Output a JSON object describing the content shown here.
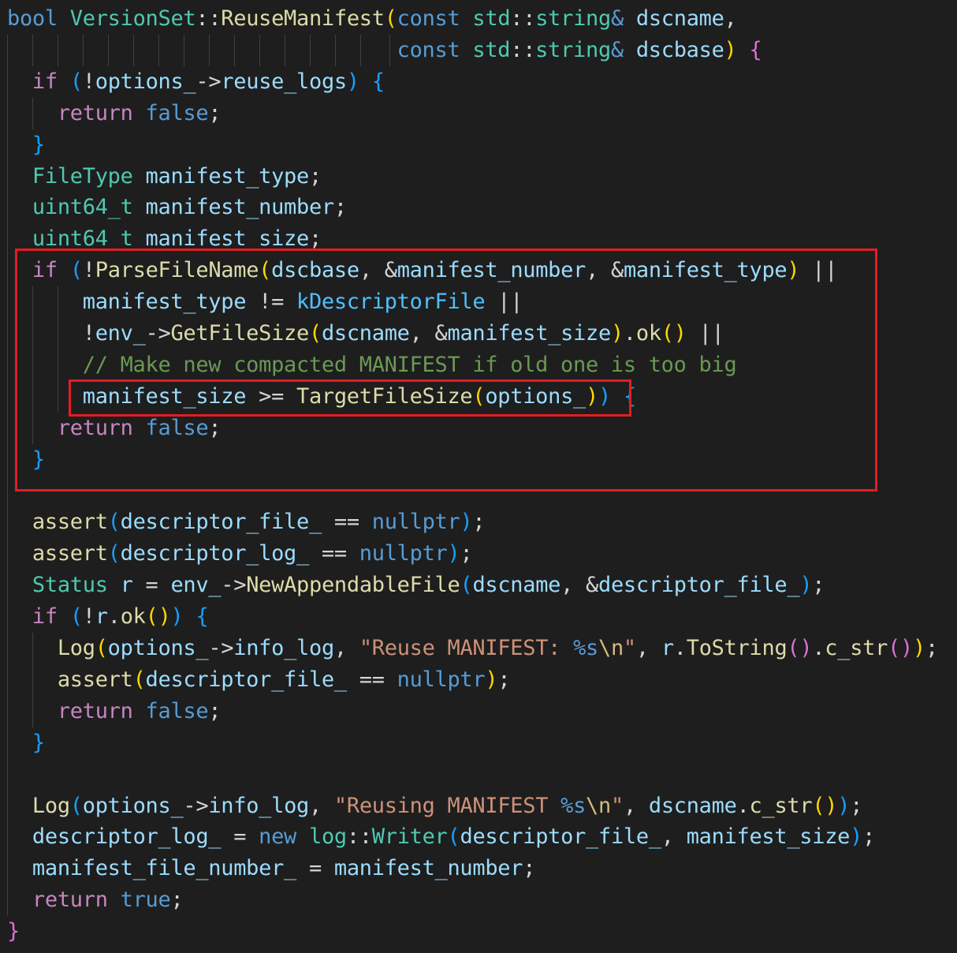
{
  "colors": {
    "background": "#1e1e1e",
    "keyword": "#569cd6",
    "control": "#c586c0",
    "type": "#4ec9b0",
    "variable": "#9cdcfe",
    "function": "#dcdcaa",
    "string": "#ce9178",
    "escape": "#d7ba7d",
    "comment": "#6a9955",
    "highlight_box": "#e51c23"
  },
  "code": [
    [
      [
        "k",
        "bool"
      ],
      [
        "p",
        " "
      ],
      [
        "t",
        "VersionSet"
      ],
      [
        "p",
        "::"
      ],
      [
        "f",
        "ReuseManifest"
      ],
      [
        "b1",
        "("
      ],
      [
        "k",
        "const"
      ],
      [
        "p",
        " "
      ],
      [
        "t",
        "std"
      ],
      [
        "p",
        "::"
      ],
      [
        "t",
        "string"
      ],
      [
        "k",
        "&"
      ],
      [
        "p",
        " "
      ],
      [
        "v",
        "dscname"
      ],
      [
        "p",
        ","
      ]
    ],
    [
      [
        "p",
        "                               "
      ],
      [
        "k",
        "const"
      ],
      [
        "p",
        " "
      ],
      [
        "t",
        "std"
      ],
      [
        "p",
        "::"
      ],
      [
        "t",
        "string"
      ],
      [
        "k",
        "&"
      ],
      [
        "p",
        " "
      ],
      [
        "v",
        "dscbase"
      ],
      [
        "b1",
        ")"
      ],
      [
        "p",
        " "
      ],
      [
        "b2",
        "{"
      ]
    ],
    [
      [
        "p",
        "  "
      ],
      [
        "c",
        "if"
      ],
      [
        "p",
        " "
      ],
      [
        "b3",
        "("
      ],
      [
        "p",
        "!"
      ],
      [
        "v",
        "options_"
      ],
      [
        "p",
        "->"
      ],
      [
        "v",
        "reuse_logs"
      ],
      [
        "b3",
        ")"
      ],
      [
        "p",
        " "
      ],
      [
        "b3",
        "{"
      ]
    ],
    [
      [
        "p",
        "    "
      ],
      [
        "c",
        "return"
      ],
      [
        "p",
        " "
      ],
      [
        "k",
        "false"
      ],
      [
        "p",
        ";"
      ]
    ],
    [
      [
        "p",
        "  "
      ],
      [
        "b3",
        "}"
      ]
    ],
    [
      [
        "p",
        "  "
      ],
      [
        "t",
        "FileType"
      ],
      [
        "p",
        " "
      ],
      [
        "v",
        "manifest_type"
      ],
      [
        "p",
        ";"
      ]
    ],
    [
      [
        "p",
        "  "
      ],
      [
        "t",
        "uint64_t"
      ],
      [
        "p",
        " "
      ],
      [
        "v",
        "manifest_number"
      ],
      [
        "p",
        ";"
      ]
    ],
    [
      [
        "p",
        "  "
      ],
      [
        "t",
        "uint64_t"
      ],
      [
        "p",
        " "
      ],
      [
        "v",
        "manifest_size"
      ],
      [
        "p",
        ";"
      ]
    ],
    [
      [
        "p",
        "  "
      ],
      [
        "c",
        "if"
      ],
      [
        "p",
        " "
      ],
      [
        "b3",
        "("
      ],
      [
        "p",
        "!"
      ],
      [
        "f",
        "ParseFileName"
      ],
      [
        "b1",
        "("
      ],
      [
        "v",
        "dscbase"
      ],
      [
        "p",
        ", &"
      ],
      [
        "v",
        "manifest_number"
      ],
      [
        "p",
        ", &"
      ],
      [
        "v",
        "manifest_type"
      ],
      [
        "b1",
        ")"
      ],
      [
        "p",
        " ||"
      ]
    ],
    [
      [
        "p",
        "      "
      ],
      [
        "v",
        "manifest_type"
      ],
      [
        "p",
        " != "
      ],
      [
        "cn",
        "kDescriptorFile"
      ],
      [
        "p",
        " ||"
      ]
    ],
    [
      [
        "p",
        "      !"
      ],
      [
        "v",
        "env_"
      ],
      [
        "p",
        "->"
      ],
      [
        "f",
        "GetFileSize"
      ],
      [
        "b1",
        "("
      ],
      [
        "v",
        "dscname"
      ],
      [
        "p",
        ", &"
      ],
      [
        "v",
        "manifest_size"
      ],
      [
        "b1",
        ")"
      ],
      [
        "p",
        "."
      ],
      [
        "f",
        "ok"
      ],
      [
        "b1",
        "()"
      ],
      [
        "p",
        " ||"
      ]
    ],
    [
      [
        "p",
        "      "
      ],
      [
        "cm",
        "// Make new compacted MANIFEST if old one is too big"
      ]
    ],
    [
      [
        "p",
        "      "
      ],
      [
        "v",
        "manifest_size"
      ],
      [
        "p",
        " >= "
      ],
      [
        "f",
        "TargetFileSize"
      ],
      [
        "b1",
        "("
      ],
      [
        "v",
        "options_"
      ],
      [
        "b1",
        ")"
      ],
      [
        "b3",
        ")"
      ],
      [
        "p",
        " "
      ],
      [
        "b3",
        "{"
      ]
    ],
    [
      [
        "p",
        "    "
      ],
      [
        "c",
        "return"
      ],
      [
        "p",
        " "
      ],
      [
        "k",
        "false"
      ],
      [
        "p",
        ";"
      ]
    ],
    [
      [
        "p",
        "  "
      ],
      [
        "b3",
        "}"
      ]
    ],
    [],
    [
      [
        "p",
        "  "
      ],
      [
        "f",
        "assert"
      ],
      [
        "b3",
        "("
      ],
      [
        "v",
        "descriptor_file_"
      ],
      [
        "p",
        " == "
      ],
      [
        "k",
        "nullptr"
      ],
      [
        "b3",
        ")"
      ],
      [
        "p",
        ";"
      ]
    ],
    [
      [
        "p",
        "  "
      ],
      [
        "f",
        "assert"
      ],
      [
        "b3",
        "("
      ],
      [
        "v",
        "descriptor_log_"
      ],
      [
        "p",
        " == "
      ],
      [
        "k",
        "nullptr"
      ],
      [
        "b3",
        ")"
      ],
      [
        "p",
        ";"
      ]
    ],
    [
      [
        "p",
        "  "
      ],
      [
        "t",
        "Status"
      ],
      [
        "p",
        " "
      ],
      [
        "v",
        "r"
      ],
      [
        "p",
        " = "
      ],
      [
        "v",
        "env_"
      ],
      [
        "p",
        "->"
      ],
      [
        "f",
        "NewAppendableFile"
      ],
      [
        "b3",
        "("
      ],
      [
        "v",
        "dscname"
      ],
      [
        "p",
        ", &"
      ],
      [
        "v",
        "descriptor_file_"
      ],
      [
        "b3",
        ")"
      ],
      [
        "p",
        ";"
      ]
    ],
    [
      [
        "p",
        "  "
      ],
      [
        "c",
        "if"
      ],
      [
        "p",
        " "
      ],
      [
        "b3",
        "("
      ],
      [
        "p",
        "!"
      ],
      [
        "v",
        "r"
      ],
      [
        "p",
        "."
      ],
      [
        "f",
        "ok"
      ],
      [
        "b1",
        "()"
      ],
      [
        "b3",
        ")"
      ],
      [
        "p",
        " "
      ],
      [
        "b3",
        "{"
      ]
    ],
    [
      [
        "p",
        "    "
      ],
      [
        "f",
        "Log"
      ],
      [
        "b1",
        "("
      ],
      [
        "v",
        "options_"
      ],
      [
        "p",
        "->"
      ],
      [
        "v",
        "info_log"
      ],
      [
        "p",
        ", "
      ],
      [
        "s",
        "\"Reuse MANIFEST: "
      ],
      [
        "k",
        "%s"
      ],
      [
        "e",
        "\\n"
      ],
      [
        "s",
        "\""
      ],
      [
        "p",
        ", "
      ],
      [
        "v",
        "r"
      ],
      [
        "p",
        "."
      ],
      [
        "f",
        "ToString"
      ],
      [
        "b2",
        "()"
      ],
      [
        "p",
        "."
      ],
      [
        "f",
        "c_str"
      ],
      [
        "b2",
        "()"
      ],
      [
        "b1",
        ")"
      ],
      [
        "p",
        ";"
      ]
    ],
    [
      [
        "p",
        "    "
      ],
      [
        "f",
        "assert"
      ],
      [
        "b1",
        "("
      ],
      [
        "v",
        "descriptor_file_"
      ],
      [
        "p",
        " == "
      ],
      [
        "k",
        "nullptr"
      ],
      [
        "b1",
        ")"
      ],
      [
        "p",
        ";"
      ]
    ],
    [
      [
        "p",
        "    "
      ],
      [
        "c",
        "return"
      ],
      [
        "p",
        " "
      ],
      [
        "k",
        "false"
      ],
      [
        "p",
        ";"
      ]
    ],
    [
      [
        "p",
        "  "
      ],
      [
        "b3",
        "}"
      ]
    ],
    [],
    [
      [
        "p",
        "  "
      ],
      [
        "f",
        "Log"
      ],
      [
        "b3",
        "("
      ],
      [
        "v",
        "options_"
      ],
      [
        "p",
        "->"
      ],
      [
        "v",
        "info_log"
      ],
      [
        "p",
        ", "
      ],
      [
        "s",
        "\"Reusing MANIFEST "
      ],
      [
        "k",
        "%s"
      ],
      [
        "e",
        "\\n"
      ],
      [
        "s",
        "\""
      ],
      [
        "p",
        ", "
      ],
      [
        "v",
        "dscname"
      ],
      [
        "p",
        "."
      ],
      [
        "f",
        "c_str"
      ],
      [
        "b1",
        "()"
      ],
      [
        "b3",
        ")"
      ],
      [
        "p",
        ";"
      ]
    ],
    [
      [
        "p",
        "  "
      ],
      [
        "v",
        "descriptor_log_"
      ],
      [
        "p",
        " = "
      ],
      [
        "k",
        "new"
      ],
      [
        "p",
        " "
      ],
      [
        "t",
        "log"
      ],
      [
        "p",
        "::"
      ],
      [
        "t",
        "Writer"
      ],
      [
        "b3",
        "("
      ],
      [
        "v",
        "descriptor_file_"
      ],
      [
        "p",
        ", "
      ],
      [
        "v",
        "manifest_size"
      ],
      [
        "b3",
        ")"
      ],
      [
        "p",
        ";"
      ]
    ],
    [
      [
        "p",
        "  "
      ],
      [
        "v",
        "manifest_file_number_"
      ],
      [
        "p",
        " = "
      ],
      [
        "v",
        "manifest_number"
      ],
      [
        "p",
        ";"
      ]
    ],
    [
      [
        "p",
        "  "
      ],
      [
        "c",
        "return"
      ],
      [
        "p",
        " "
      ],
      [
        "k",
        "true"
      ],
      [
        "p",
        ";"
      ]
    ],
    [
      [
        "b2",
        "}"
      ]
    ]
  ]
}
